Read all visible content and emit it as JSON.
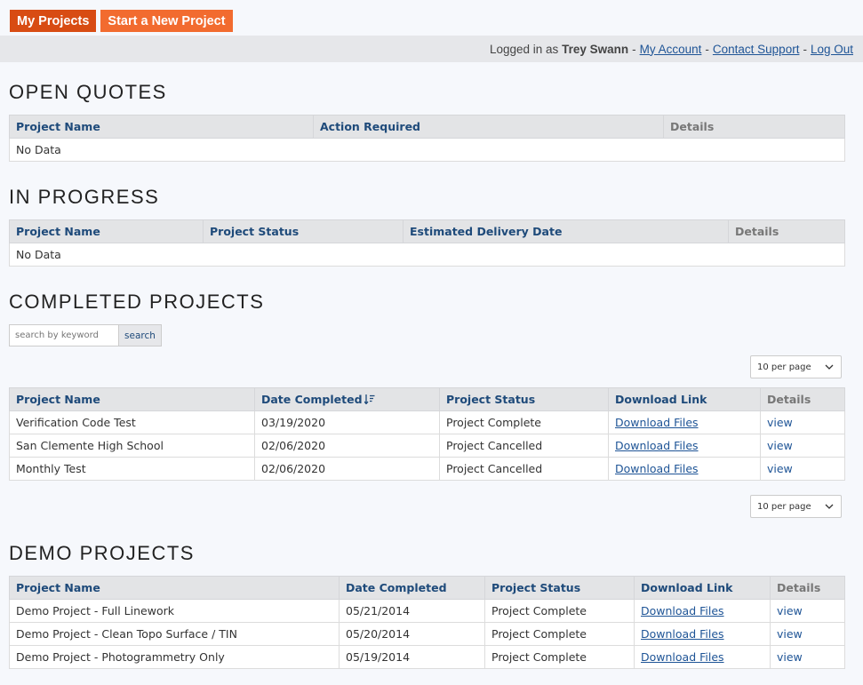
{
  "top_buttons": {
    "my_projects": "My Projects",
    "new_project": "Start a New Project"
  },
  "userbar": {
    "prefix": "Logged in as",
    "user_name": "Trey Swann",
    "my_account": "My Account",
    "contact_support": "Contact Support",
    "log_out": "Log Out"
  },
  "open_quotes": {
    "title": "OPEN QUOTES",
    "headers": [
      "Project Name",
      "Action Required",
      "Details"
    ],
    "empty": "No Data"
  },
  "in_progress": {
    "title": "IN PROGRESS",
    "headers": [
      "Project Name",
      "Project Status",
      "Estimated Delivery Date",
      "Details"
    ],
    "empty": "No Data"
  },
  "completed": {
    "title": "COMPLETED PROJECTS",
    "search_placeholder": "search by keyword",
    "search_button": "search",
    "per_page": "10 per page",
    "headers": [
      "Project Name",
      "Date Completed",
      "Project Status",
      "Download Link",
      "Details"
    ],
    "rows": [
      {
        "name": "Verification Code Test",
        "date": "03/19/2020",
        "status": "Project Complete",
        "download": "Download Files",
        "details": "view"
      },
      {
        "name": "San Clemente High School",
        "date": "02/06/2020",
        "status": "Project Cancelled",
        "download": "Download Files",
        "details": "view"
      },
      {
        "name": "Monthly Test",
        "date": "02/06/2020",
        "status": "Project Cancelled",
        "download": "Download Files",
        "details": "view"
      }
    ]
  },
  "demo": {
    "title": "DEMO PROJECTS",
    "headers": [
      "Project Name",
      "Date Completed",
      "Project Status",
      "Download Link",
      "Details"
    ],
    "rows": [
      {
        "name": "Demo Project - Full Linework",
        "date": "05/21/2014",
        "status": "Project Complete",
        "download": "Download Files",
        "details": "view"
      },
      {
        "name": "Demo Project - Clean Topo Surface / TIN",
        "date": "05/20/2014",
        "status": "Project Complete",
        "download": "Download Files",
        "details": "view"
      },
      {
        "name": "Demo Project - Photogrammetry Only",
        "date": "05/19/2014",
        "status": "Project Complete",
        "download": "Download Files",
        "details": "view"
      }
    ]
  },
  "colors": {
    "brand_dark": "#d84c13",
    "brand_light": "#f26b2f",
    "link": "#1e5496",
    "header_text": "#1e4a7a"
  }
}
